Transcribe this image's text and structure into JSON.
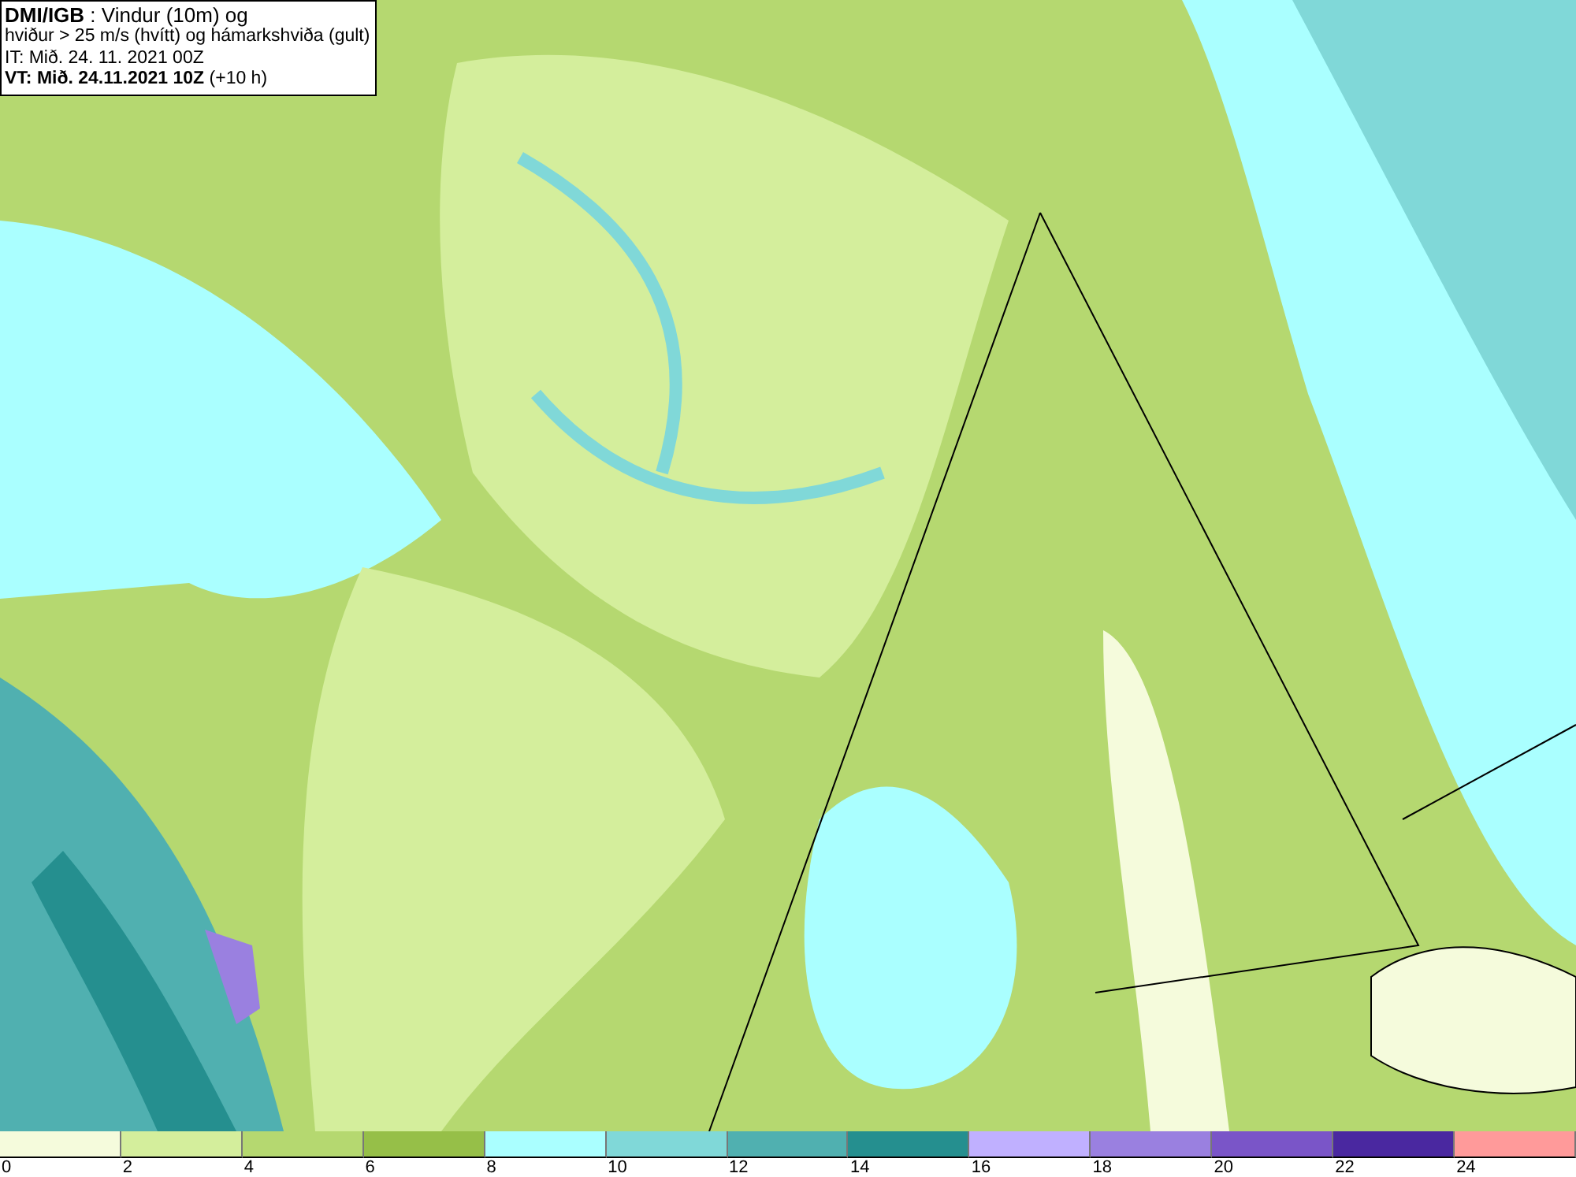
{
  "title_box": {
    "lines": [
      "**DMI/IGB** : Vindur (10m) og",
      "hviður > 25 m/s (hvítt) og hámarkshviða (gult)",
      "IT: Mið. 24. 11. 2021 00Z",
      "**VT: Mið. 24.11.2021 10Z** (+10 h)"
    ]
  },
  "legend": [
    {
      "label": "0",
      "color": "#f5fbdc"
    },
    {
      "label": "2",
      "color": "#d4ee9c"
    },
    {
      "label": "4",
      "color": "#b5d870"
    },
    {
      "label": "6",
      "color": "#96bf48"
    },
    {
      "label": "8",
      "color": "#aaffff"
    },
    {
      "label": "10",
      "color": "#80d8d8"
    },
    {
      "label": "12",
      "color": "#50b0b0"
    },
    {
      "label": "14",
      "color": "#258f8f"
    },
    {
      "label": "16",
      "color": "#c0b0ff"
    },
    {
      "label": "18",
      "color": "#9a80e0"
    },
    {
      "label": "20",
      "color": "#7a55c8"
    },
    {
      "label": "22",
      "color": "#4a28a0"
    },
    {
      "label": "24",
      "color": "#ff9a9a"
    }
  ]
}
